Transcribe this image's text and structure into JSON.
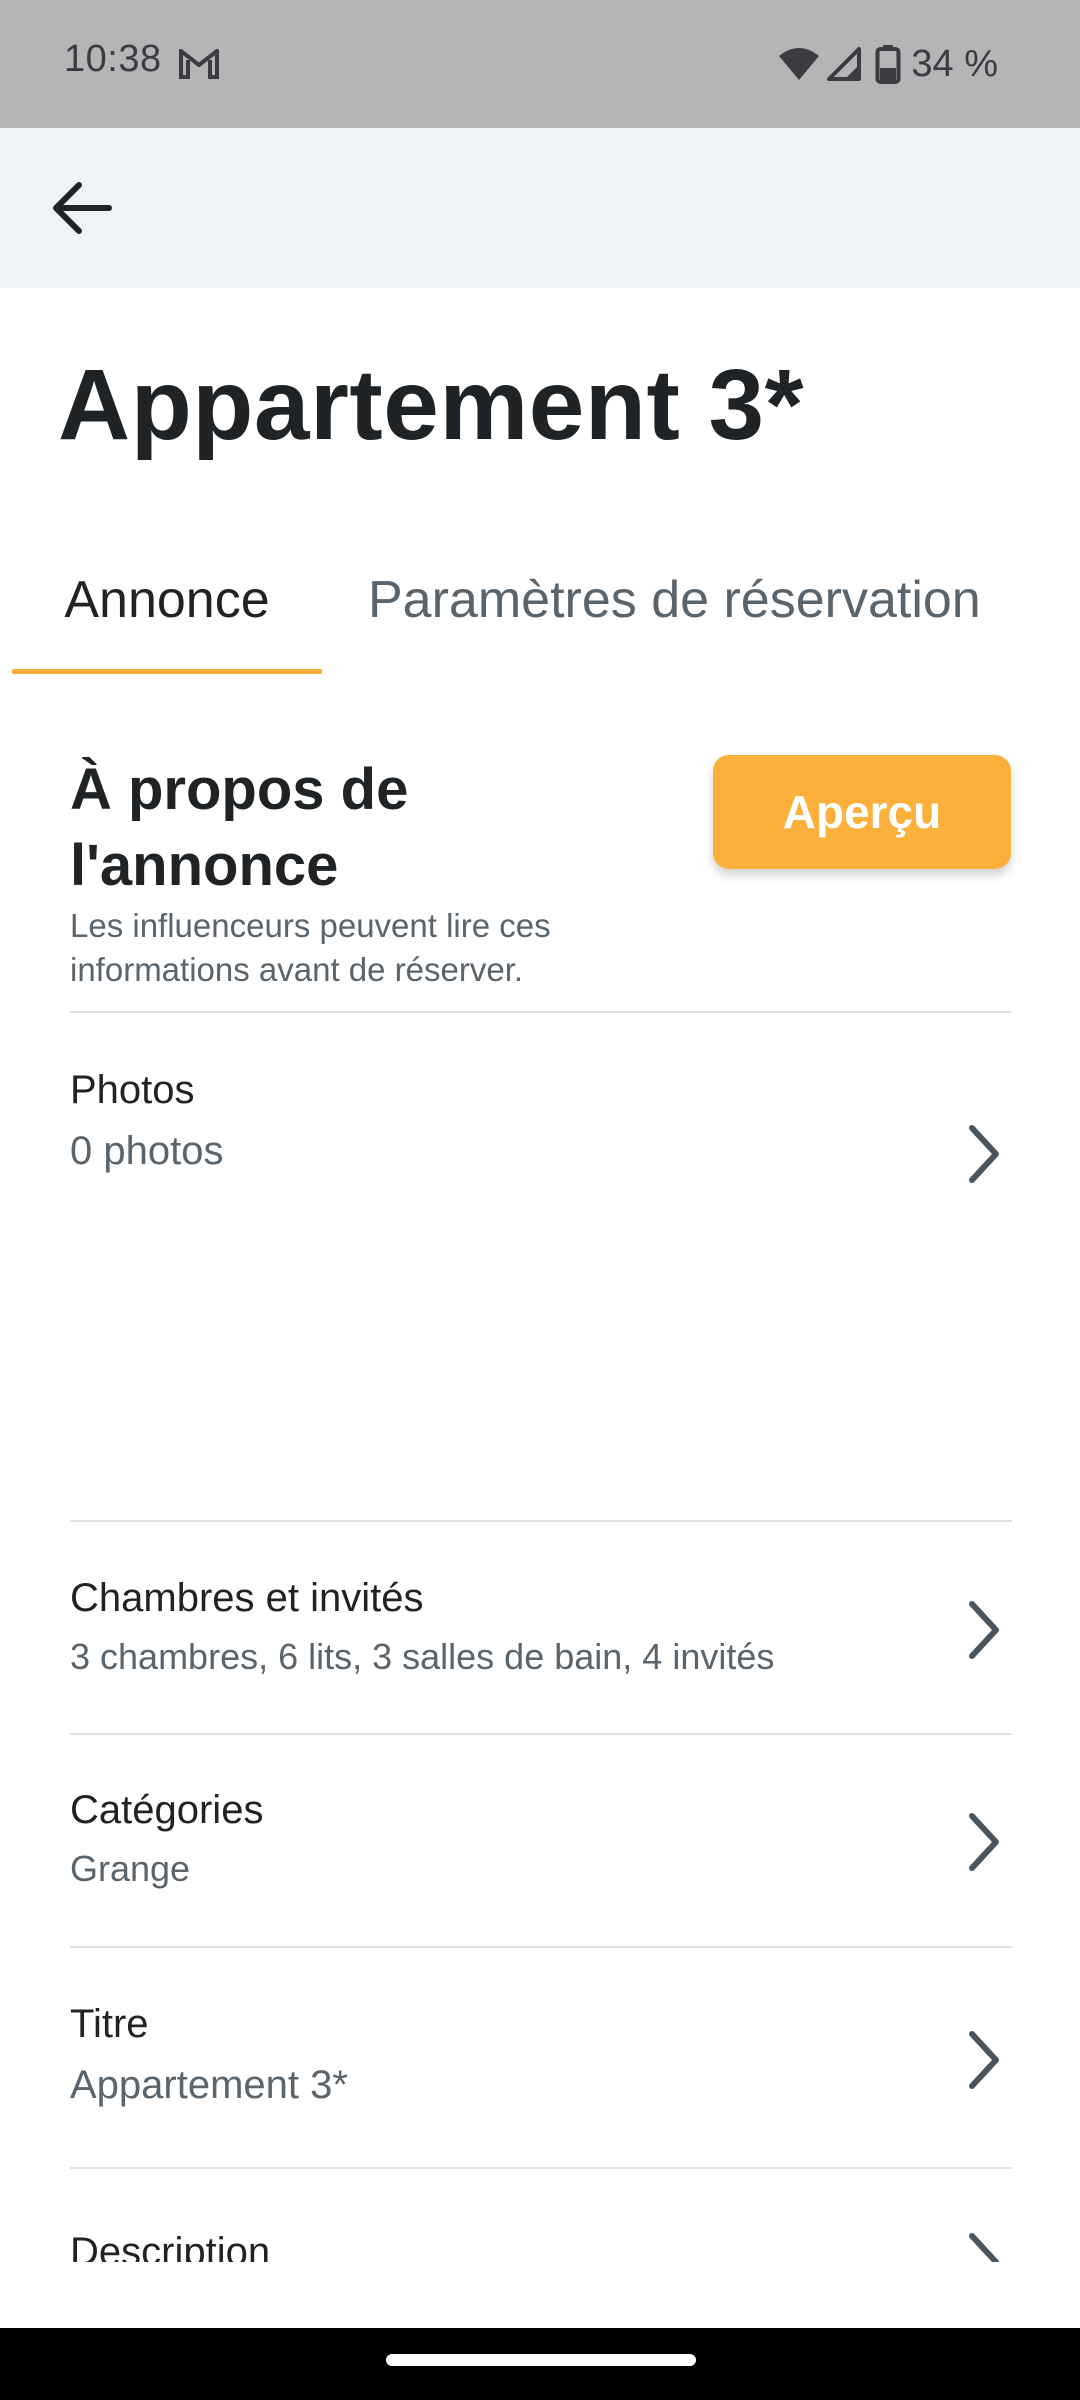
{
  "status_bar": {
    "time": "10:38",
    "battery": "34 %",
    "icons": [
      "gmail-icon",
      "wifi-icon",
      "signal-icon",
      "battery-icon"
    ]
  },
  "header": {
    "back_icon": "arrow-left-icon"
  },
  "page": {
    "title": "Appartement 3*"
  },
  "tabs": [
    {
      "label": "Annonce",
      "selected": true
    },
    {
      "label": "Paramètres de réservation",
      "selected": false
    }
  ],
  "section": {
    "title": "À propos de l'annonce",
    "subtitle": "Les influenceurs peuvent lire ces informations avant de réserver.",
    "preview_button": "Aperçu"
  },
  "rows": [
    {
      "label": "Photos",
      "value": "0 photos"
    },
    {
      "label": "Chambres et invités",
      "value": "3 chambres, 6 lits, 3 salles de bain, 4 invités"
    },
    {
      "label": "Catégories",
      "value": "Grange"
    },
    {
      "label": "Titre",
      "value": "Appartement 3*"
    },
    {
      "label": "Description",
      "value": ""
    }
  ],
  "colors": {
    "accent": "#fbb03b",
    "tab_indicator": "#f5ad3a",
    "header_bg": "#eff3f6",
    "status_bar_bg": "#b4b5b7",
    "text_primary": "#1f2326",
    "text_secondary": "#5a646c"
  }
}
